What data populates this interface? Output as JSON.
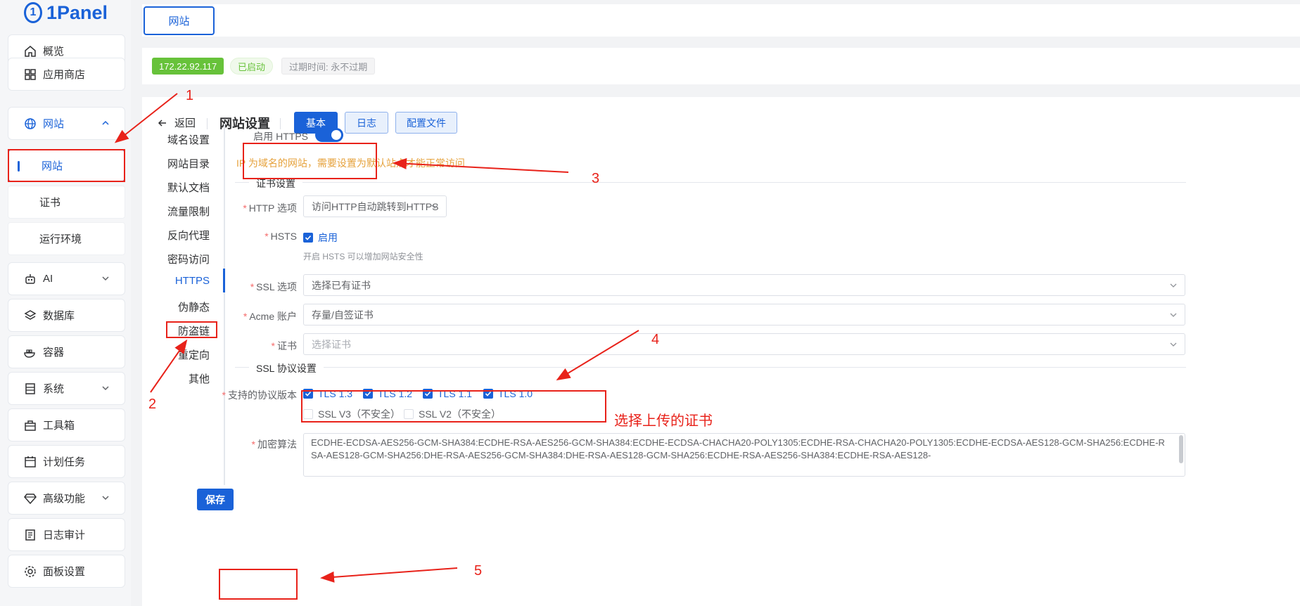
{
  "brand": {
    "name": "1Panel"
  },
  "sidebar": {
    "items": [
      {
        "label": "概览",
        "icon": "home-icon"
      },
      {
        "label": "应用商店",
        "icon": "grid-icon"
      },
      {
        "label": "网站",
        "icon": "globe-icon"
      },
      {
        "label": "AI",
        "icon": "robot-icon"
      },
      {
        "label": "数据库",
        "icon": "layers-icon"
      },
      {
        "label": "容器",
        "icon": "docker-icon"
      },
      {
        "label": "系统",
        "icon": "server-icon"
      },
      {
        "label": "工具箱",
        "icon": "toolbox-icon"
      },
      {
        "label": "计划任务",
        "icon": "calendar-icon"
      },
      {
        "label": "高级功能",
        "icon": "diamond-icon"
      },
      {
        "label": "日志审计",
        "icon": "log-icon"
      },
      {
        "label": "面板设置",
        "icon": "gear-icon"
      }
    ],
    "subitems": [
      {
        "label": "网站"
      },
      {
        "label": "证书"
      },
      {
        "label": "运行环境"
      }
    ]
  },
  "tabbar": {
    "tab_label": "网站"
  },
  "infobar": {
    "ip": "172.22.92.117",
    "status": "已启动",
    "expire": "过期时间: 永不过期"
  },
  "header": {
    "back_label": "返回",
    "title": "网站设置",
    "buttons": {
      "basic": "基本",
      "log": "日志",
      "config": "配置文件"
    }
  },
  "submenu": {
    "items": [
      "域名设置",
      "网站目录",
      "默认文档",
      "流量限制",
      "反向代理",
      "密码访问",
      "HTTPS",
      "伪静态",
      "防盗链",
      "重定向",
      "其他"
    ],
    "active": "HTTPS"
  },
  "form": {
    "https_label": "启用 HTTPS",
    "https_enabled": true,
    "ip_warning": "IP 为域名的网站，需要设置为默认站点才能正常访问",
    "cert_section": "证书设置",
    "http_option_label": "HTTP 选项",
    "http_option_value": "访问HTTP自动跳转到HTTPS",
    "hsts_label": "HSTS",
    "hsts_enable": "启用",
    "hsts_hint": "开启 HSTS 可以增加网站安全性",
    "ssl_option_label": "SSL 选项",
    "ssl_option_value": "选择已有证书",
    "acme_label": "Acme 账户",
    "acme_value": "存量/自签证书",
    "cert_label": "证书",
    "cert_placeholder": "选择证书",
    "ssl_protocol_section": "SSL 协议设置",
    "protocol_label": "支持的协议版本",
    "protocols_checked": [
      "TLS 1.3",
      "TLS 1.2",
      "TLS 1.1",
      "TLS 1.0"
    ],
    "protocols_unchecked": [
      "SSL V3（不安全）",
      "SSL V2（不安全）"
    ],
    "cipher_label": "加密算法",
    "cipher_value": "ECDHE-ECDSA-AES256-GCM-SHA384:ECDHE-RSA-AES256-GCM-SHA384:ECDHE-ECDSA-CHACHA20-POLY1305:ECDHE-RSA-CHACHA20-POLY1305:ECDHE-ECDSA-AES128-GCM-SHA256:ECDHE-RSA-AES128-GCM-SHA256:DHE-RSA-AES256-GCM-SHA384:DHE-RSA-AES128-GCM-SHA256:ECDHE-RSA-AES256-SHA384:ECDHE-RSA-AES128-",
    "save_label": "保存"
  },
  "annotations": {
    "n1": "1",
    "n2": "2",
    "n3": "3",
    "n4": "4",
    "n5": "5",
    "cert_note": "选择上传的证书",
    "color": "#e8221a"
  },
  "colors": {
    "primary": "#1a62d8",
    "success": "#67c23a",
    "warning": "#e6a23c",
    "danger": "#f56c6c"
  }
}
